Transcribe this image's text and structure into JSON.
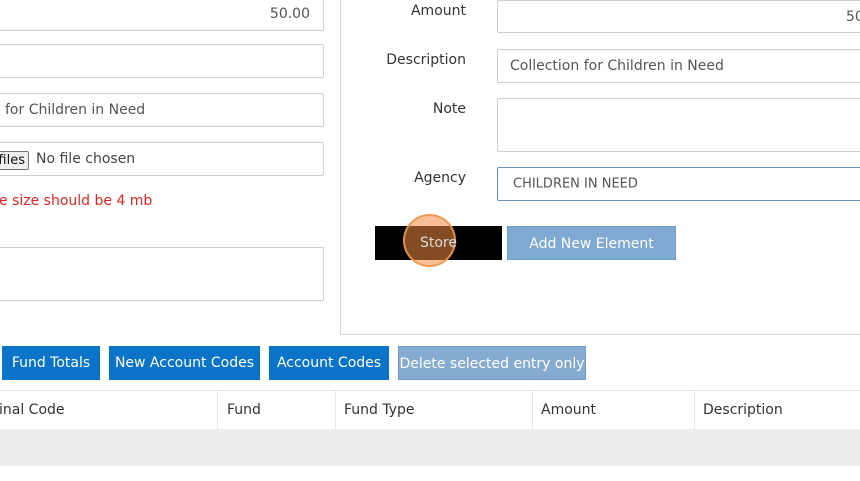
{
  "left_form": {
    "amount_value": "50.00",
    "description_value": "for Children in Need",
    "file_button_label": "files",
    "file_status": "No file chosen",
    "file_size_warning": "e size should be 4 mb"
  },
  "right_form": {
    "amount_label": "Amount",
    "amount_value": "50",
    "description_label": "Description",
    "description_value": "Collection for Children in Need",
    "note_label": "Note",
    "agency_label": "Agency",
    "agency_value": "CHILDREN IN NEED",
    "store_label": "Store",
    "add_new_label": "Add New Element"
  },
  "toolbar": {
    "fund_totals": "Fund Totals",
    "new_account_codes": "New Account Codes",
    "account_codes": "Account Codes",
    "delete_selected": "Delete selected entry only"
  },
  "table": {
    "columns": [
      "inal Code",
      "Fund",
      "Fund Type",
      "Amount",
      "Description"
    ]
  },
  "colors": {
    "primary_button": "#0b74c8",
    "disabled_button": "#86abd1",
    "warning_text": "#e02424",
    "store_button": "#000000"
  }
}
